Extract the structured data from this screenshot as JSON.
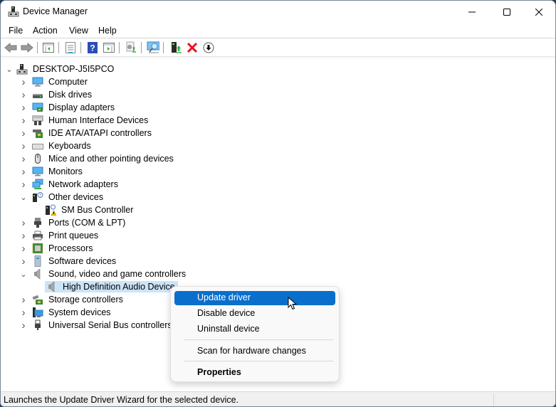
{
  "window": {
    "title": "Device Manager",
    "controls": {
      "minimize": "minimize",
      "maximize": "maximize",
      "close": "close"
    }
  },
  "menubar": {
    "items": [
      "File",
      "Action",
      "View",
      "Help"
    ]
  },
  "toolbar": {
    "buttons": [
      {
        "name": "back",
        "icon": "back-arrow-icon"
      },
      {
        "name": "forward",
        "icon": "forward-arrow-icon"
      },
      {
        "name": "show-hide-console-tree",
        "icon": "console-tree-icon"
      },
      {
        "name": "properties",
        "icon": "properties-sheet-icon"
      },
      {
        "name": "help",
        "icon": "help-icon"
      },
      {
        "name": "show-hide-action-pane",
        "icon": "action-pane-icon"
      },
      {
        "name": "update-driver",
        "icon": "update-driver-icon"
      },
      {
        "name": "scan-hardware-changes",
        "icon": "scan-monitor-icon"
      },
      {
        "name": "add-legacy-hardware",
        "icon": "add-device-icon"
      },
      {
        "name": "uninstall-device",
        "icon": "uninstall-x-icon"
      },
      {
        "name": "disable-device",
        "icon": "disable-down-arrow-icon"
      }
    ]
  },
  "tree": {
    "root": "DESKTOP-J5I5PCO",
    "items": [
      {
        "label": "Computer",
        "icon": "computer-icon",
        "expanded": false,
        "level": 1
      },
      {
        "label": "Disk drives",
        "icon": "disk-drive-icon",
        "expanded": false,
        "level": 1
      },
      {
        "label": "Display adapters",
        "icon": "display-adapter-icon",
        "expanded": false,
        "level": 1
      },
      {
        "label": "Human Interface Devices",
        "icon": "hid-icon",
        "expanded": false,
        "level": 1
      },
      {
        "label": "IDE ATA/ATAPI controllers",
        "icon": "ide-controller-icon",
        "expanded": false,
        "level": 1
      },
      {
        "label": "Keyboards",
        "icon": "keyboard-icon",
        "expanded": false,
        "level": 1
      },
      {
        "label": "Mice and other pointing devices",
        "icon": "mouse-icon",
        "expanded": false,
        "level": 1
      },
      {
        "label": "Monitors",
        "icon": "monitor-icon",
        "expanded": false,
        "level": 1
      },
      {
        "label": "Network adapters",
        "icon": "network-adapter-icon",
        "expanded": false,
        "level": 1
      },
      {
        "label": "Other devices",
        "icon": "unknown-device-icon",
        "expanded": true,
        "level": 1
      },
      {
        "label": "SM Bus Controller",
        "icon": "warning-device-icon",
        "level": 2
      },
      {
        "label": "Ports (COM & LPT)",
        "icon": "port-icon",
        "expanded": false,
        "level": 1
      },
      {
        "label": "Print queues",
        "icon": "printer-icon",
        "expanded": false,
        "level": 1
      },
      {
        "label": "Processors",
        "icon": "processor-icon",
        "expanded": false,
        "level": 1
      },
      {
        "label": "Software devices",
        "icon": "software-device-icon",
        "expanded": false,
        "level": 1
      },
      {
        "label": "Sound, video and game controllers",
        "icon": "speaker-icon",
        "expanded": true,
        "level": 1
      },
      {
        "label": "High Definition Audio Device",
        "icon": "speaker-icon",
        "level": 2,
        "selected": true
      },
      {
        "label": "Storage controllers",
        "icon": "storage-controller-icon",
        "expanded": false,
        "level": 1
      },
      {
        "label": "System devices",
        "icon": "system-device-icon",
        "expanded": false,
        "level": 1
      },
      {
        "label": "Universal Serial Bus controllers",
        "icon": "usb-icon",
        "expanded": false,
        "level": 1
      }
    ]
  },
  "context_menu": {
    "items": [
      {
        "label": "Update driver",
        "highlighted": true
      },
      {
        "label": "Disable device"
      },
      {
        "label": "Uninstall device"
      },
      {
        "separator": true
      },
      {
        "label": "Scan for hardware changes"
      },
      {
        "separator": true
      },
      {
        "label": "Properties",
        "bold": true
      }
    ]
  },
  "statusbar": {
    "text": "Launches the Update Driver Wizard for the selected device."
  },
  "colors": {
    "selection": "#cce4f7",
    "menu_highlight": "#0a6fcc",
    "uninstall_red": "#e81123"
  }
}
